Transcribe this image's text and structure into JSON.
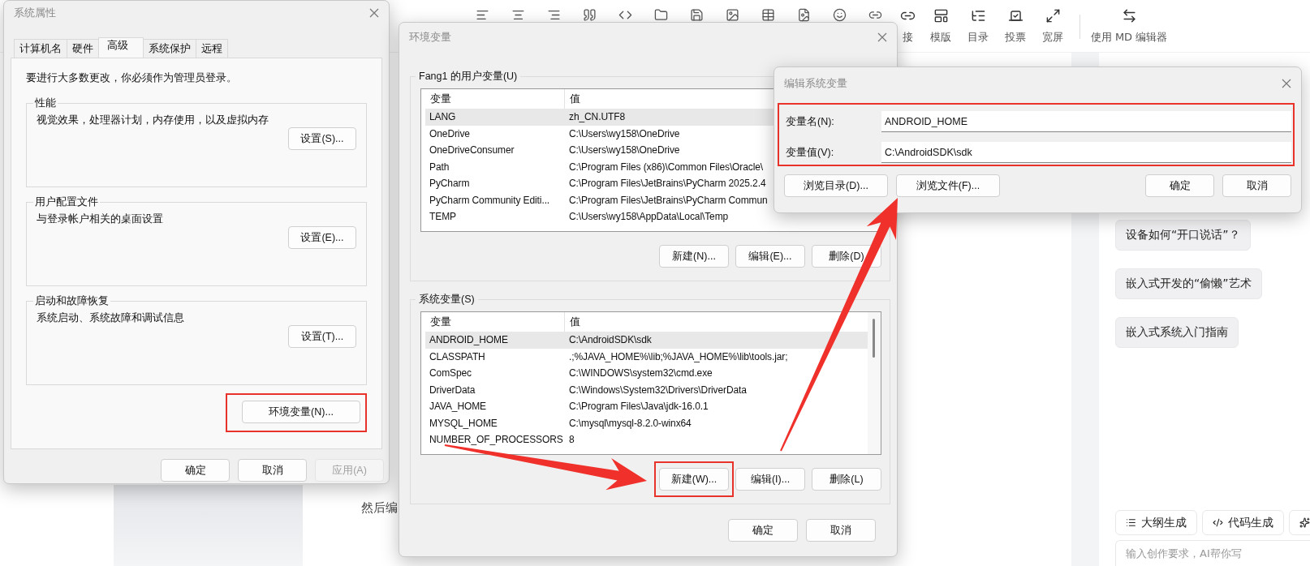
{
  "background": {
    "toolbar": [
      {
        "label": "接",
        "kind": "link"
      },
      {
        "label": "模版",
        "kind": "template"
      },
      {
        "label": "目录",
        "kind": "toc"
      },
      {
        "label": "投票",
        "kind": "vote"
      },
      {
        "label": "宽屏",
        "kind": "wide"
      },
      {
        "label": "使用 MD 编辑器",
        "kind": "switch"
      }
    ],
    "article_text": "然后编",
    "suggestions": [
      "设备如何“开口说话”？",
      "嵌入式开发的“偷懒”艺术",
      "嵌入式系统入门指南"
    ],
    "ai_tools": [
      {
        "label": "大纲生成",
        "kind": "outline"
      },
      {
        "label": "代码生成",
        "kind": "code"
      },
      {
        "kind": "more"
      }
    ],
    "ai_input": {
      "placeholder": "输入创作要求，AI帮你写"
    }
  },
  "system_properties": {
    "title": "系统属性",
    "tabs": [
      {
        "label": "计算机名",
        "selected": false
      },
      {
        "label": "硬件",
        "selected": false
      },
      {
        "label": "高级",
        "selected": true
      },
      {
        "label": "系统保护",
        "selected": false
      },
      {
        "label": "远程",
        "selected": false
      }
    ],
    "notice": "要进行大多数更改，你必须作为管理员登录。",
    "groups": [
      {
        "title": "性能",
        "description": "视觉效果，处理器计划，内存使用，以及虚拟内存",
        "button": "设置(S)..."
      },
      {
        "title": "用户配置文件",
        "description": "与登录帐户相关的桌面设置",
        "button": "设置(E)..."
      },
      {
        "title": "启动和故障恢复",
        "description": "系统启动、系统故障和调试信息",
        "button": "设置(T)..."
      }
    ],
    "env_button": {
      "label": "环境变量(N)...",
      "highlighted": true
    },
    "buttons": [
      {
        "label": "确定",
        "disabled": false
      },
      {
        "label": "取消",
        "disabled": false
      },
      {
        "label": "应用(A)",
        "disabled": true
      }
    ]
  },
  "environment_variables": {
    "title": "环境变量",
    "user_group": {
      "title": "Fang1 的用户变量(U)",
      "columns": [
        "变量",
        "值"
      ],
      "rows": [
        {
          "name": "LANG",
          "value": "zh_CN.UTF8",
          "selected": true
        },
        {
          "name": "OneDrive",
          "value": "C:\\Users\\wy158\\OneDrive",
          "selected": false
        },
        {
          "name": "OneDriveConsumer",
          "value": "C:\\Users\\wy158\\OneDrive",
          "selected": false
        },
        {
          "name": "Path",
          "value": "C:\\Program Files (x86)\\Common Files\\Oracle\\",
          "selected": false
        },
        {
          "name": "PyCharm",
          "value": "C:\\Program Files\\JetBrains\\PyCharm 2025.2.4",
          "selected": false
        },
        {
          "name": "PyCharm Community Editi...",
          "value": "C:\\Program Files\\JetBrains\\PyCharm Commun",
          "selected": false
        },
        {
          "name": "TEMP",
          "value": "C:\\Users\\wy158\\AppData\\Local\\Temp",
          "selected": false
        }
      ],
      "buttons": [
        {
          "label": "新建(N)...",
          "highlighted": false
        },
        {
          "label": "编辑(E)...",
          "highlighted": false
        },
        {
          "label": "删除(D)",
          "highlighted": false
        }
      ]
    },
    "system_group": {
      "title": "系统变量(S)",
      "columns": [
        "变量",
        "值"
      ],
      "rows": [
        {
          "name": "ANDROID_HOME",
          "value": "C:\\AndroidSDK\\sdk",
          "selected": true
        },
        {
          "name": "CLASSPATH",
          "value": ".;%JAVA_HOME%\\lib;%JAVA_HOME%\\lib\\tools.jar;",
          "selected": false
        },
        {
          "name": "ComSpec",
          "value": "C:\\WINDOWS\\system32\\cmd.exe",
          "selected": false
        },
        {
          "name": "DriverData",
          "value": "C:\\Windows\\System32\\Drivers\\DriverData",
          "selected": false
        },
        {
          "name": "JAVA_HOME",
          "value": "C:\\Program Files\\Java\\jdk-16.0.1",
          "selected": false
        },
        {
          "name": "MYSQL_HOME",
          "value": "C:\\mysql\\mysql-8.2.0-winx64",
          "selected": false
        },
        {
          "name": "NUMBER_OF_PROCESSORS",
          "value": "8",
          "selected": false
        }
      ],
      "buttons": [
        {
          "label": "新建(W)...",
          "highlighted": true
        },
        {
          "label": "编辑(I)...",
          "highlighted": false
        },
        {
          "label": "删除(L)",
          "highlighted": false
        }
      ]
    },
    "buttons": [
      {
        "label": "确定"
      },
      {
        "label": "取消"
      }
    ]
  },
  "edit_dialog": {
    "title": "编辑系统变量",
    "fields_highlighted": true,
    "fields": [
      {
        "label": "变量名(N):",
        "value": "ANDROID_HOME"
      },
      {
        "label": "变量值(V):",
        "value": "C:\\AndroidSDK\\sdk"
      }
    ],
    "left_buttons": [
      {
        "label": "浏览目录(D)..."
      },
      {
        "label": "浏览文件(F)..."
      }
    ],
    "right_buttons": [
      {
        "label": "确定"
      },
      {
        "label": "取消"
      }
    ]
  }
}
